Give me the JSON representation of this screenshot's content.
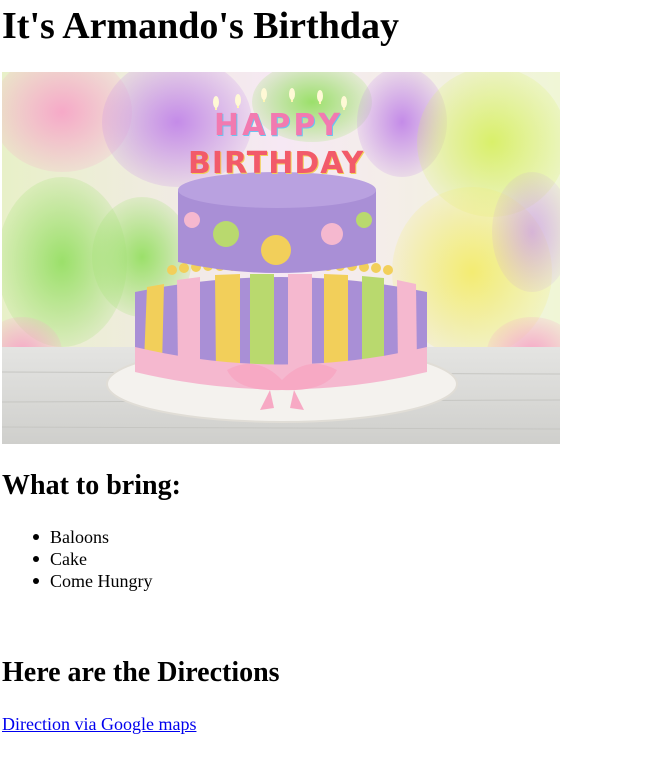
{
  "page": {
    "title": "It's Armando's Birthday"
  },
  "hero": {
    "image_alt": "Birthday cake with HAPPY BIRTHDAY candles and balloons",
    "candle_text_top": "HAPPY",
    "candle_text_bottom": "BIRTHDAY"
  },
  "bring": {
    "heading": "What to bring:",
    "items": [
      "Baloons",
      "Cake",
      "Come Hungry"
    ]
  },
  "directions": {
    "heading": "Here are the Directions",
    "link_label": "Direction via Google maps"
  },
  "colors": {
    "link": "#0000ee",
    "cake_purple": "#a98fd6",
    "cake_pink": "#f5b8cf",
    "cake_yellow": "#f2cf5a",
    "cake_green": "#b9d96e"
  }
}
